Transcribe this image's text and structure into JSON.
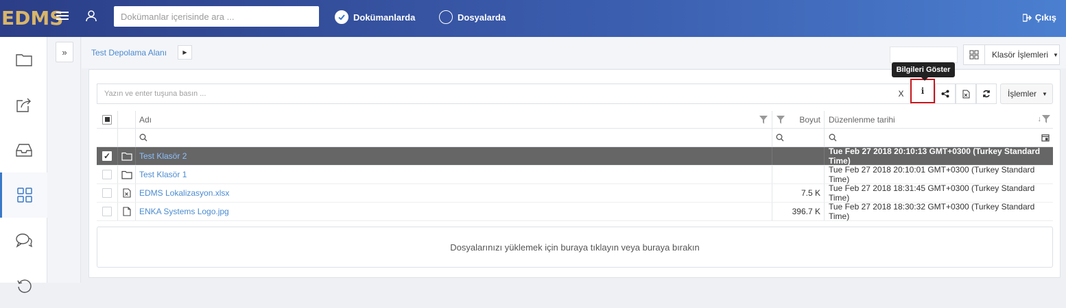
{
  "header": {
    "logo": "EDMS",
    "search_placeholder": "Dokümanlar içerisinde ara ...",
    "radio_documents": "Dokümanlarda",
    "radio_files": "Dosyalarda",
    "logout_label": "Çıkış"
  },
  "breadcrumb": {
    "root": "Test Depolama Alanı"
  },
  "folder_actions_label": "Klasör İşlemleri",
  "toolbar": {
    "filter_placeholder": "Yazın ve enter tuşuna basın ...",
    "clear_label": "X",
    "info_label": "i",
    "tooltip": "Bilgileri Göster",
    "actions_label": "İşlemler"
  },
  "table": {
    "columns": {
      "name": "Adı",
      "size": "Boyut",
      "modified": "Düzenlenme tarihi"
    },
    "rows": [
      {
        "name": "Test Klasör 2",
        "size": "",
        "modified": "Tue Feb 27 2018 20:10:13 GMT+0300 (Turkey Standard Time)",
        "type": "folder",
        "selected": true
      },
      {
        "name": "Test Klasör 1",
        "size": "",
        "modified": "Tue Feb 27 2018 20:10:01 GMT+0300 (Turkey Standard Time)",
        "type": "folder",
        "selected": false
      },
      {
        "name": "EDMS Lokalizasyon.xlsx",
        "size": "7.5 K",
        "modified": "Tue Feb 27 2018 18:31:45 GMT+0300 (Turkey Standard Time)",
        "type": "excel",
        "selected": false
      },
      {
        "name": "ENKA Systems Logo.jpg",
        "size": "396.7 K",
        "modified": "Tue Feb 27 2018 18:30:32 GMT+0300 (Turkey Standard Time)",
        "type": "file",
        "selected": false
      }
    ]
  },
  "dropzone_text": "Dosyalarınızı yüklemek için buraya tıklayın veya buraya bırakın",
  "colors": {
    "header_start": "#2b3e87",
    "header_end": "#4b7fd0",
    "logo": "#d8b56a",
    "link": "#4a8bd0",
    "selected_row": "#666666",
    "highlight": "#c4161c"
  }
}
